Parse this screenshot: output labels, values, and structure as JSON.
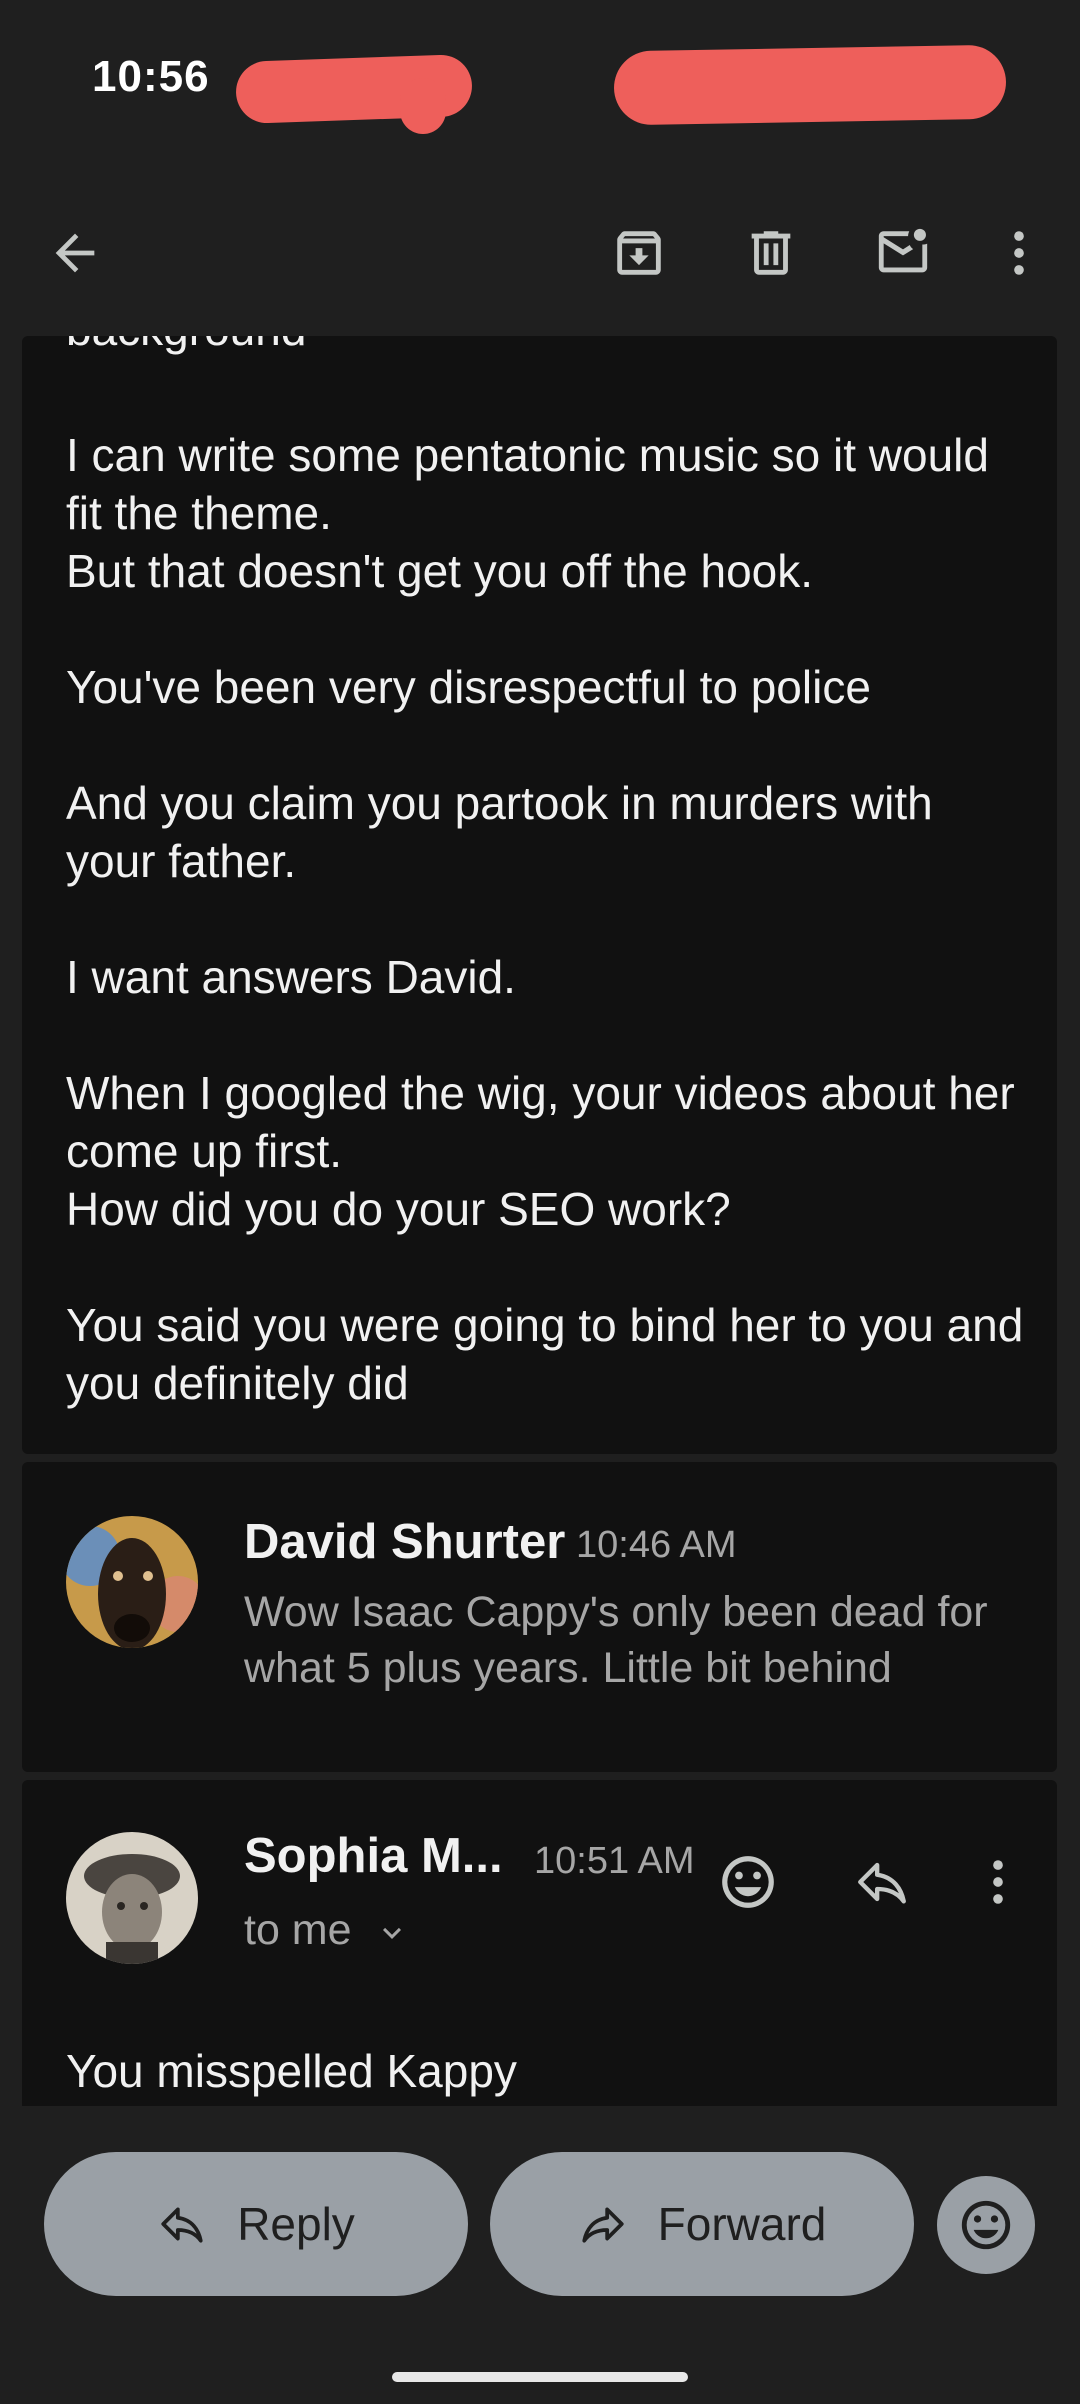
{
  "status_bar": {
    "time": "10:56"
  },
  "toolbar": {
    "icons": [
      "back-arrow-icon",
      "archive-icon",
      "delete-icon",
      "mark-unread-icon",
      "more-vertical-icon"
    ]
  },
  "message_body": {
    "partial_top_line": "background",
    "paragraphs": [
      "I can write some pentatonic music so it would fit the theme.\nBut that doesn't get you off the hook.",
      "You've been very disrespectful to police",
      "And you claim you partook in murders with your father.",
      "I want answers David.",
      "When I googled the wig, your videos about her come up first.\nHow did you do your SEO work?",
      "You said you were going to bind her to you and you definitely did"
    ]
  },
  "collapsed_message": {
    "sender": "David Shurter",
    "time": "10:46 AM",
    "snippet": "Wow Isaac Cappy's only been dead for what 5 plus years. Little bit behind"
  },
  "expanded_message": {
    "sender": "Sophia M...",
    "time": "10:51 AM",
    "recipient": "to me",
    "body": "You misspelled Kappy"
  },
  "actions": {
    "reply_label": "Reply",
    "forward_label": "Forward"
  },
  "colors": {
    "background": "#1f1f1f",
    "card": "#111111",
    "pill": "#9aa0a6",
    "redaction": "#ee5f5b"
  }
}
